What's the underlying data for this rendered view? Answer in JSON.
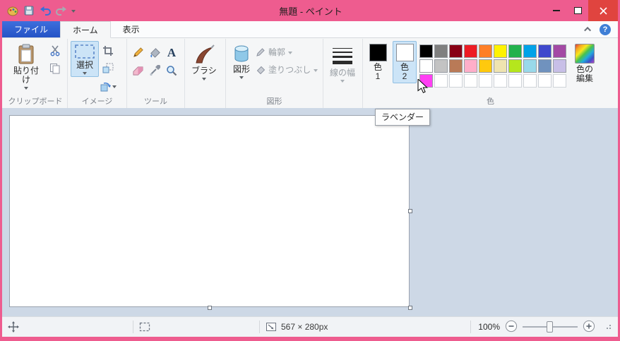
{
  "window": {
    "title": "無題 - ペイント"
  },
  "tabs": {
    "file": "ファイル",
    "home": "ホーム",
    "view": "表示"
  },
  "help_glyph": "?",
  "ribbon": {
    "clipboard": {
      "group_label": "クリップボード",
      "paste_label": "貼り付け"
    },
    "image": {
      "group_label": "イメージ",
      "select_label": "選択"
    },
    "tools": {
      "group_label": "ツール",
      "text_glyph": "A"
    },
    "brushes": {
      "button_label": "ブラシ"
    },
    "shapes": {
      "group_label": "図形",
      "button_label": "図形",
      "outline_label": "輪郭",
      "fill_label": "塗りつぶし"
    },
    "line_width": {
      "button_label": "線の幅"
    },
    "colors": {
      "group_label": "色",
      "color1_label": "色\n1",
      "color2_label": "色\n2",
      "edit_label": "色の\n編集",
      "color1_value": "#000000",
      "color2_value": "#ffffff",
      "palette": [
        [
          "#000000",
          "#7f7f7f",
          "#880015",
          "#ed1c24",
          "#ff7f27",
          "#fff200",
          "#22b14c",
          "#00a2e8",
          "#3f48cc",
          "#a349a4"
        ],
        [
          "#ffffff",
          "#c3c3c3",
          "#b97a57",
          "#ffaec9",
          "#ffc90e",
          "#efe4b0",
          "#b5e61d",
          "#99d9ea",
          "#7092be",
          "#c8bfe7"
        ],
        [
          "#ff3ff3",
          null,
          null,
          null,
          null,
          null,
          null,
          null,
          null,
          null
        ]
      ]
    }
  },
  "tooltip": {
    "text": "ラベンダー"
  },
  "statusbar": {
    "canvas_size": "567 × 280px",
    "zoom_level": "100%"
  }
}
